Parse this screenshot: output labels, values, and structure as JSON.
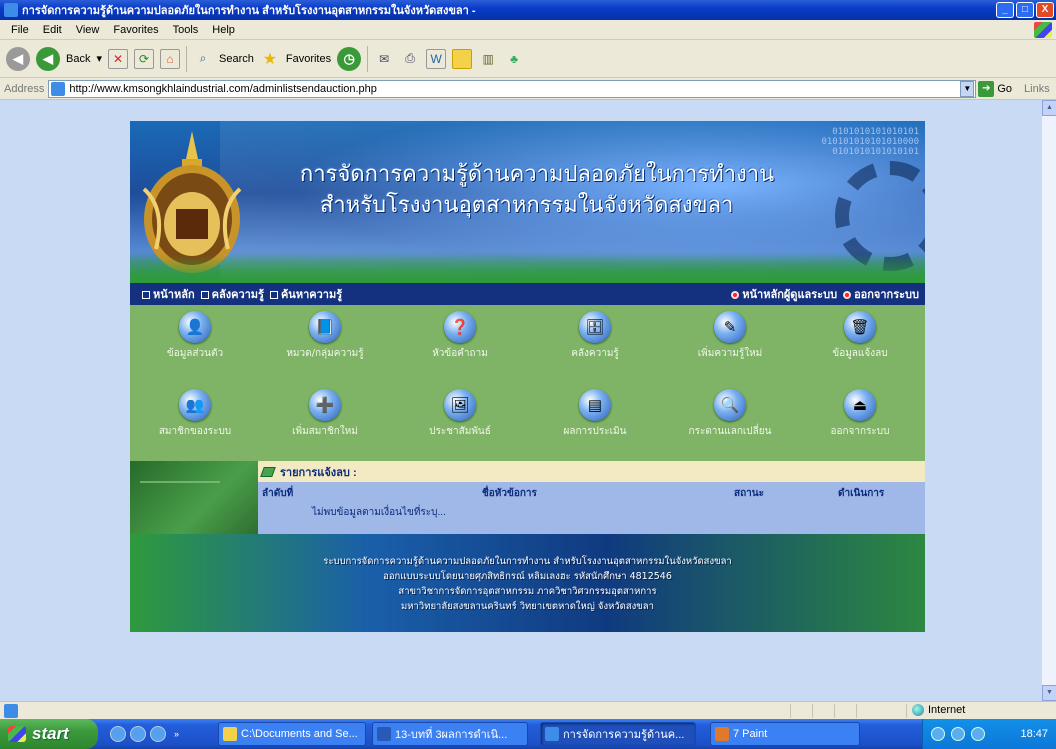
{
  "window": {
    "title": "การจัดการความรู้ด้านความปลอดภัยในการทำงาน สำหรับโรงงานอุตสาหกรรมในจังหวัดสงขลา -",
    "controls": [
      "_",
      "□",
      "X"
    ]
  },
  "menu": [
    "File",
    "Edit",
    "View",
    "Favorites",
    "Tools",
    "Help"
  ],
  "toolbar": {
    "back_label": "Back",
    "search_label": "Search",
    "favorites_label": "Favorites"
  },
  "address": {
    "label": "Address",
    "url": "http://www.kmsongkhlaindustrial.com/adminlistsendauction.php",
    "go_label": "Go",
    "links_label": "Links"
  },
  "banner": {
    "title_line1": "การจัดการความรู้ด้านความปลอดภัยในการทำงาน",
    "title_line2": "สำหรับโรงงานอุตสาหกรรมในจังหวัดสงขลา",
    "binary1": "0101010101010101",
    "binary2": "010101010101010000",
    "binary3": "0101010101010101"
  },
  "nav": {
    "left": [
      "หน้าหลัก",
      "คลังความรู้",
      "ค้นหาความรู้"
    ],
    "right": [
      "หน้าหลักผู้ดูแลระบบ",
      "ออกจากระบบ"
    ]
  },
  "icons": [
    {
      "label": "ข้อมูลส่วนตัว",
      "icon": "user-icon",
      "glyph": "👤"
    },
    {
      "label": "หมวด/กลุ่มความรู้",
      "icon": "book-icon",
      "glyph": "📘"
    },
    {
      "label": "หัวข้อคำถาม",
      "icon": "question-icon",
      "glyph": "❓"
    },
    {
      "label": "คลังความรู้",
      "icon": "database-icon",
      "glyph": "🗄"
    },
    {
      "label": "เพิ่มความรู้ใหม่",
      "icon": "edit-icon",
      "glyph": "✎"
    },
    {
      "label": "ข้อมูลแจ้งลบ",
      "icon": "delete-report-icon",
      "glyph": "🗑"
    },
    {
      "label": "สมาชิกของระบบ",
      "icon": "members-icon",
      "glyph": "👥"
    },
    {
      "label": "เพิ่มสมาชิกใหม่",
      "icon": "add-member-icon",
      "glyph": "➕"
    },
    {
      "label": "ประชาสัมพันธ์",
      "icon": "announce-icon",
      "glyph": "🖼"
    },
    {
      "label": "ผลการประเมิน",
      "icon": "evaluation-icon",
      "glyph": "▤"
    },
    {
      "label": "กระดานแลกเปลี่ยน",
      "icon": "board-icon",
      "glyph": "🔍"
    },
    {
      "label": "ออกจากระบบ",
      "icon": "logout-icon",
      "glyph": "⏏"
    }
  ],
  "report": {
    "heading": "รายการแจ้งลบ :",
    "columns": [
      "ลำดับที่",
      "ชื่อหัวข้อการ",
      "สถานะ",
      "ดำเนินการ"
    ],
    "empty_message": "ไม่พบข้อมูลตามเงื่อนไขที่ระบุ..."
  },
  "footer": {
    "line1": "ระบบการจัดการความรู้ด้านความปลอดภัยในการทำงาน สำหรับโรงงานอุตสาหกรรมในจังหวัดสงขลา",
    "line2": "ออกแบบระบบโดยนายศุภสิทธิกรณ์ หลิมเลงฮะ รหัสนักศึกษา 4812546",
    "line3": "สาขาวิชาการจัดการอุตสาหกรรม ภาควิชาวิศวกรรมอุตสาหการ",
    "line4": "มหาวิทยาลัยสงขลานครินทร์ วิทยาเขตหาดใหญ่ จังหวัดสงขลา"
  },
  "statusbar": {
    "zone": "Internet"
  },
  "taskbar": {
    "start": "start",
    "tasks": [
      "C:\\Documents and Se...",
      "13-บทที่ 3ผลการดำเนิ...",
      "การจัดการความรู้ด้านค...",
      "7 Paint"
    ],
    "clock": "18:47"
  },
  "colors": {
    "nav_bg": "#13317e",
    "icon_panel": "#7fb365",
    "report_head": "#f3e9c3",
    "report_body": "#9fb8e8"
  }
}
